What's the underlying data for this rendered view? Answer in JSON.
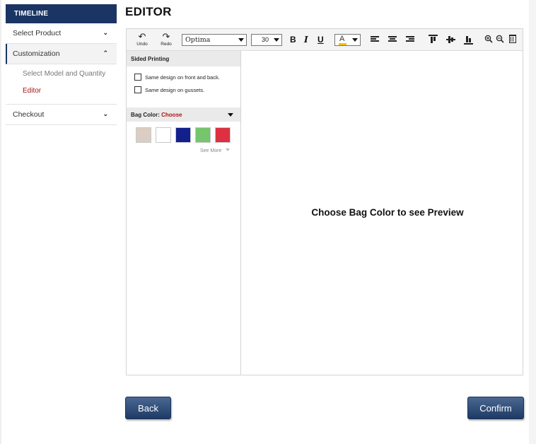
{
  "sidebar": {
    "header": "TIMELINE",
    "items": [
      {
        "label": "Select Product",
        "chevron": "⌄"
      },
      {
        "label": "Customization",
        "chevron": "⌃"
      },
      {
        "label": "Checkout",
        "chevron": "⌄"
      }
    ],
    "sub_items": [
      {
        "label": "Select Model and Quantity"
      },
      {
        "label": "Editor"
      }
    ]
  },
  "editor": {
    "title": "EDITOR",
    "toolbar": {
      "undo_label": "Undo",
      "redo_label": "Redo",
      "font": "Optima",
      "size": "30",
      "bold": "B",
      "italic": "I",
      "underline": "U",
      "text_color_glyph": "A",
      "text_color": "#f2c200"
    },
    "left_panel": {
      "sided_printing_title": "Sided Printing",
      "options": [
        {
          "label": "Same design on front and back.",
          "checked": false
        },
        {
          "label": "Same design on gussets.",
          "checked": false
        }
      ],
      "bag_color_label": "Bag Color:",
      "bag_color_value": "Choose",
      "swatches": [
        "#dccdc4",
        "#ffffff",
        "#12208e",
        "#74c56b",
        "#dd3040"
      ],
      "see_more": "See More"
    },
    "preview_message": "Choose Bag Color to see Preview"
  },
  "buttons": {
    "back": "Back",
    "confirm": "Confirm"
  },
  "colors": {
    "brand_navy": "#1a3563",
    "accent_red": "#a31515"
  }
}
